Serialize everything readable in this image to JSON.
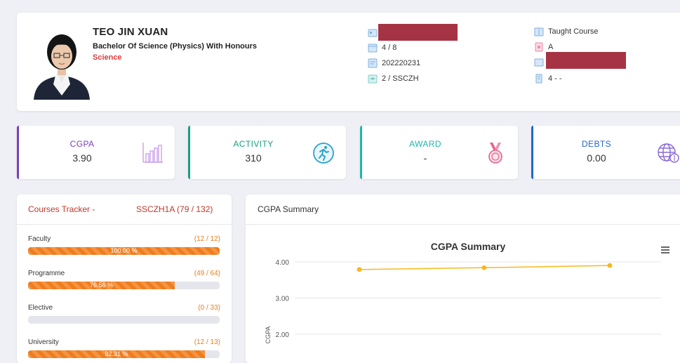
{
  "profile": {
    "name": "TEO JIN XUAN",
    "degree": "Bachelor Of Science (Physics) With Honours",
    "faculty": "Science",
    "semester": "4 / 8",
    "student_id": "202220231",
    "group": "2 / SSCZH",
    "course_type": "Taught Course",
    "status": "A",
    "level": "4 - -"
  },
  "stats": [
    {
      "label": "CGPA",
      "value": "3.90",
      "color": "#7b3fb8",
      "icon": "bar-chart-icon"
    },
    {
      "label": "ACTIVITY",
      "value": "310",
      "color": "#16a085",
      "icon": "running-icon"
    },
    {
      "label": "AWARD",
      "value": "-",
      "color": "#1fb5ad",
      "icon": "medal-icon"
    },
    {
      "label": "DEBTS",
      "value": "0.00",
      "color": "#2268c7",
      "icon": "globe-dollar-icon"
    }
  ],
  "tracker": {
    "title": "Courses Tracker -",
    "program": "SSCZH1A (79 / 132)",
    "rows": [
      {
        "name": "Faculty",
        "count": "(12 / 12)",
        "percent_label": "100.00 %",
        "fraction": 1.0
      },
      {
        "name": "Programme",
        "count": "(49 / 64)",
        "percent_label": "76.56 %",
        "fraction": 0.7656
      },
      {
        "name": "Elective",
        "count": "(0 / 33)",
        "percent_label": "",
        "fraction": 0
      },
      {
        "name": "University",
        "count": "(12 / 13)",
        "percent_label": "92.31 %",
        "fraction": 0.9231
      }
    ]
  },
  "summary": {
    "header": "CGPA Summary",
    "menu_icon": "hamburger-menu-icon"
  },
  "chart_data": {
    "type": "line",
    "title": "CGPA Summary",
    "ylabel": "CGPA",
    "y_ticks": [
      "4.00",
      "3.00",
      "2.00"
    ],
    "ylim": [
      0,
      4
    ],
    "grid": true,
    "series": [
      {
        "values": [
          3.79,
          3.84,
          3.9
        ]
      }
    ],
    "color": "#f7b81d"
  }
}
